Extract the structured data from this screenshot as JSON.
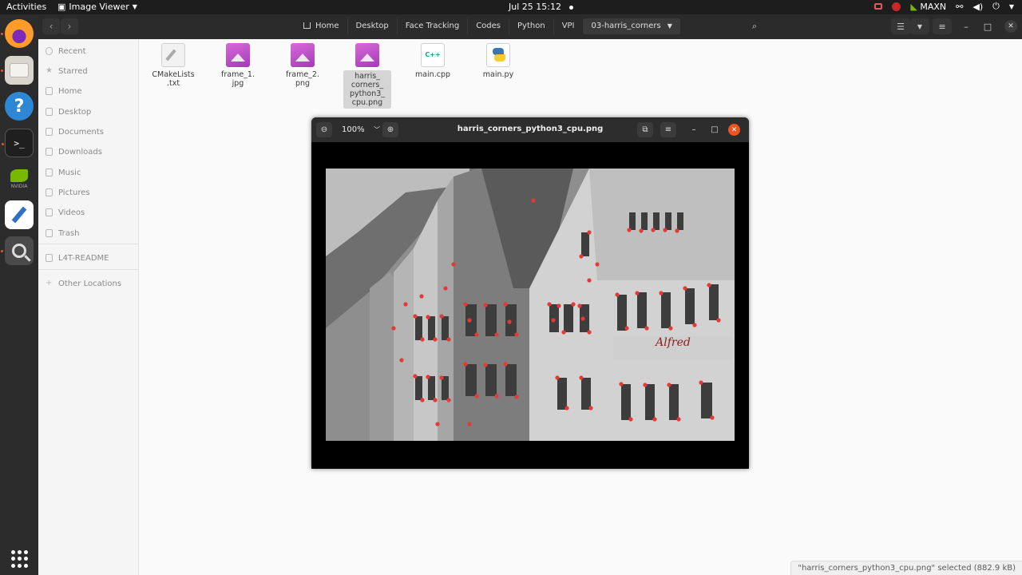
{
  "topbar": {
    "activities": "Activities",
    "app_name": "Image Viewer",
    "clock": "Jul 25  15:12",
    "power_mode": "MAXN"
  },
  "dock": {
    "items": [
      "firefox",
      "files",
      "help",
      "terminal",
      "nvidia",
      "text-editor",
      "image-search",
      "show-applications"
    ],
    "nvidia_label": "NVIDIA"
  },
  "file_manager": {
    "breadcrumbs": [
      "Home",
      "Desktop",
      "Face Tracking",
      "Codes",
      "Python",
      "VPI",
      "03-harris_corners"
    ],
    "sidebar": {
      "items": [
        "Recent",
        "Starred",
        "Home",
        "Desktop",
        "Documents",
        "Downloads",
        "Music",
        "Pictures",
        "Videos",
        "Trash",
        "L4T-README",
        "Other Locations"
      ]
    },
    "files": [
      {
        "name": "CMakeLists\n.txt",
        "type": "text"
      },
      {
        "name": "frame_1.\njpg",
        "type": "image"
      },
      {
        "name": "frame_2.\npng",
        "type": "image"
      },
      {
        "name": "harris_\ncorners_\npython3_\ncpu.png",
        "type": "image",
        "selected": true
      },
      {
        "name": "main.cpp",
        "type": "cpp"
      },
      {
        "name": "main.py",
        "type": "python"
      }
    ],
    "cpp_badge": "C++",
    "status": "\"harris_corners_python3_cpu.png\" selected  (882.9 kB)"
  },
  "viewer": {
    "title": "harris_corners_python3_cpu.png",
    "zoom": "100%",
    "accent": "#e95420",
    "corner_color": "#e53935"
  }
}
